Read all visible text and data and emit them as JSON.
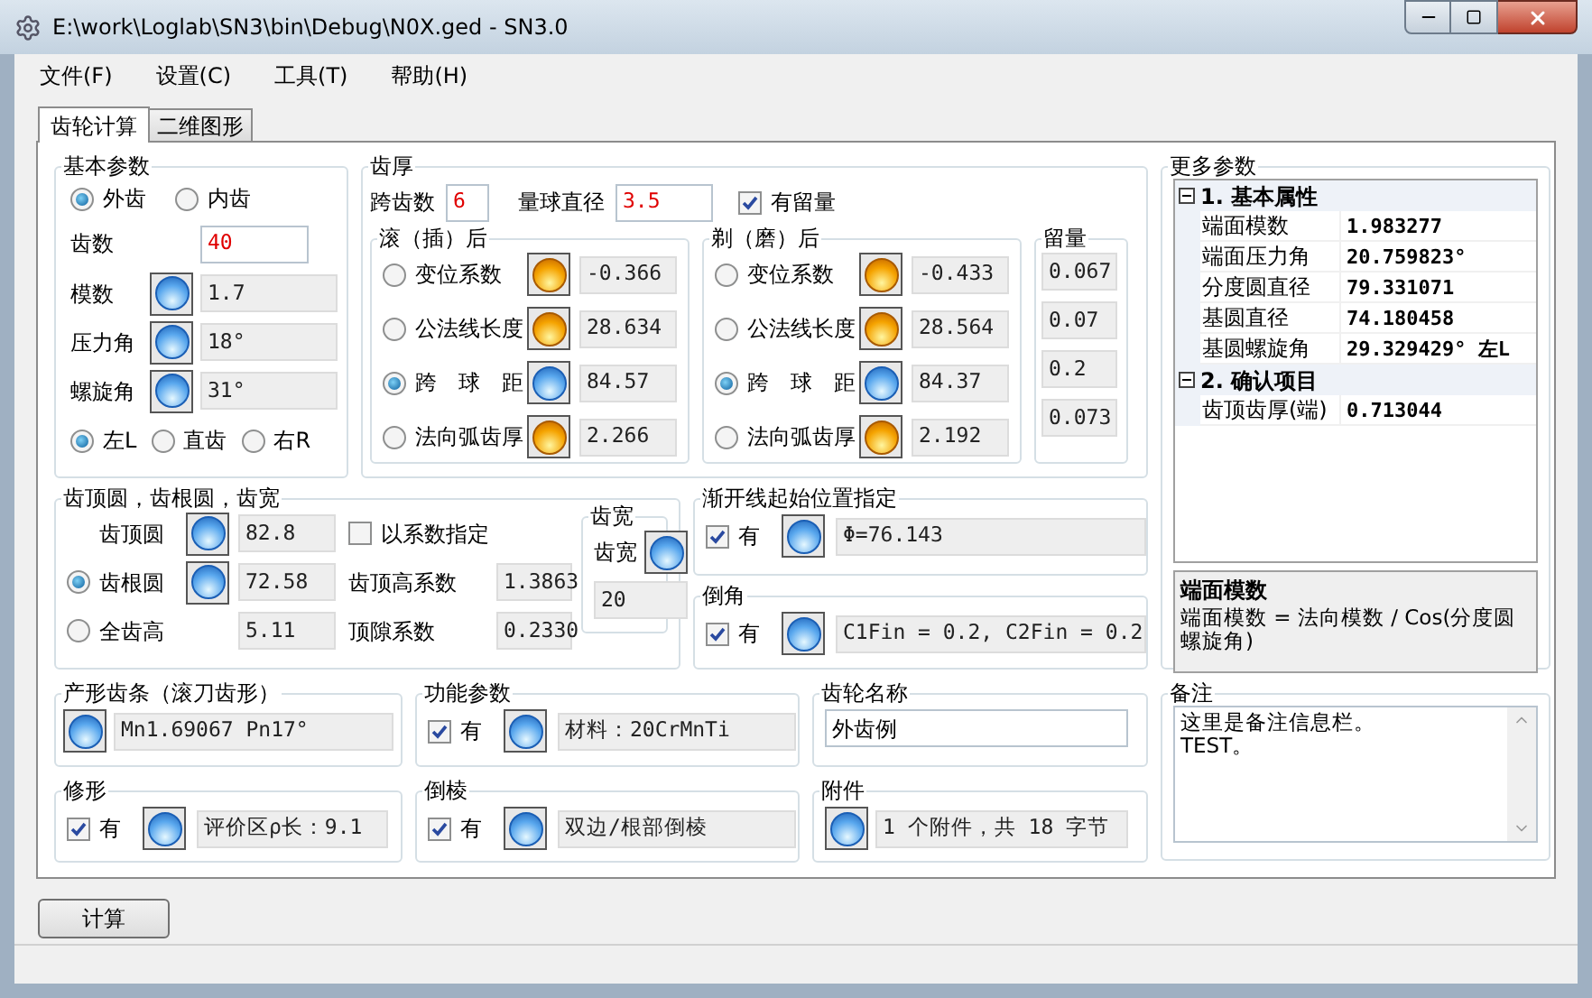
{
  "window": {
    "title": "E:\\work\\Loglab\\SN3\\bin\\Debug\\N0X.ged - SN3.0"
  },
  "menu": [
    "文件(F)",
    "设置(C)",
    "工具(T)",
    "帮助(H)"
  ],
  "tabs": [
    {
      "label": "齿轮计算",
      "selected": true
    },
    {
      "label": "二维图形",
      "selected": false
    }
  ],
  "basic": {
    "title": "基本参数",
    "gear_type": [
      {
        "label": "外齿",
        "selected": true
      },
      {
        "label": "内齿",
        "selected": false
      }
    ],
    "teeth": {
      "label": "齿数",
      "value": "40"
    },
    "params": [
      {
        "label": "模数",
        "value": "1.7"
      },
      {
        "label": "压力角",
        "value": "18°"
      },
      {
        "label": "螺旋角",
        "value": "31°"
      }
    ],
    "hand": [
      {
        "label": "左L",
        "selected": true
      },
      {
        "label": "直齿",
        "selected": false
      },
      {
        "label": "右R",
        "selected": false
      }
    ]
  },
  "thickness": {
    "title": "齿厚",
    "span": {
      "label": "跨齿数",
      "value": "6"
    },
    "ball": {
      "label": "量球直径",
      "value": "3.5"
    },
    "allowance_check": {
      "label": "有留量",
      "checked": true
    },
    "hobbed": {
      "title": "滚（插）后",
      "rows": [
        {
          "label": "变位系数",
          "selected": false,
          "warning": true,
          "value": "-0.366"
        },
        {
          "label": "公法线长度",
          "selected": false,
          "warning": true,
          "value": "28.634"
        },
        {
          "label": "跨　球　距",
          "selected": true,
          "warning": false,
          "value": "84.57"
        },
        {
          "label": "法向弧齿厚",
          "selected": false,
          "warning": true,
          "value": "2.266"
        }
      ]
    },
    "ground": {
      "title": "剃（磨）后",
      "rows": [
        {
          "label": "变位系数",
          "selected": false,
          "warning": true,
          "value": "-0.433"
        },
        {
          "label": "公法线长度",
          "selected": false,
          "warning": true,
          "value": "28.564"
        },
        {
          "label": "跨　球　距",
          "selected": true,
          "warning": false,
          "value": "84.37"
        },
        {
          "label": "法向弧齿厚",
          "selected": false,
          "warning": true,
          "value": "2.192"
        }
      ]
    },
    "allowance": {
      "title": "留量",
      "values": [
        "0.067",
        "0.07",
        "0.2",
        "0.073"
      ]
    }
  },
  "tip_root": {
    "title": "齿顶圆，齿根圆，齿宽",
    "tip": {
      "label": "齿顶圆",
      "value": "82.8"
    },
    "by_coef": {
      "label": "以系数指定",
      "checked": false
    },
    "root": {
      "label": "齿根圆",
      "selected": true,
      "value": "72.58"
    },
    "whole": {
      "label": "全齿高",
      "selected": false,
      "value": "5.11"
    },
    "addendum": {
      "label": "齿顶高系数",
      "value": "1.3863"
    },
    "clearance": {
      "label": "顶隙系数",
      "value": "0.2330"
    },
    "width": {
      "title": "齿宽",
      "label": "齿宽",
      "value": "20"
    }
  },
  "involute": {
    "title": "渐开线起始位置指定",
    "check_label": "有",
    "checked": true,
    "value": "Φ=76.143"
  },
  "chamfer": {
    "title": "倒角",
    "check_label": "有",
    "checked": true,
    "value": "C1Fin = 0.2, C2Fin = 0.2"
  },
  "rack": {
    "title": "产形齿条（滚刀齿形）",
    "value": "Mn1.69067 Pn17°"
  },
  "function": {
    "title": "功能参数",
    "check_label": "有",
    "checked": true,
    "value": "材料：20CrMnTi"
  },
  "gear_name": {
    "title": "齿轮名称",
    "value": "外齿例"
  },
  "modification": {
    "title": "修形",
    "check_label": "有",
    "checked": true,
    "value": "评价区ρ长：9.1"
  },
  "bevel": {
    "title": "倒棱",
    "check_label": "有",
    "checked": true,
    "value": "双边/根部倒棱"
  },
  "attachment": {
    "title": "附件",
    "value": "1 个附件，共 18 字节"
  },
  "more": {
    "title": "更多参数",
    "sections": [
      {
        "label": "1. 基本属性",
        "expanded": true,
        "children": [
          {
            "name": "端面模数",
            "value": "1.983277"
          },
          {
            "name": "端面压力角",
            "value": "20.759823°"
          },
          {
            "name": "分度圆直径",
            "value": "79.331071"
          },
          {
            "name": "基圆直径",
            "value": "74.180458"
          },
          {
            "name": "基圆螺旋角",
            "value": "29.329429° 左L"
          }
        ]
      },
      {
        "label": "2. 确认项目",
        "expanded": true,
        "children": [
          {
            "name": "齿顶齿厚(端)",
            "value": "0.713044"
          }
        ]
      }
    ],
    "help": {
      "title": "端面模数",
      "text": "端面模数 = 法向模数 / Cos(分度圆螺旋角)"
    }
  },
  "notes": {
    "title": "备注",
    "text": "这里是备注信息栏。\nTEST。"
  },
  "calc_button": "计算"
}
